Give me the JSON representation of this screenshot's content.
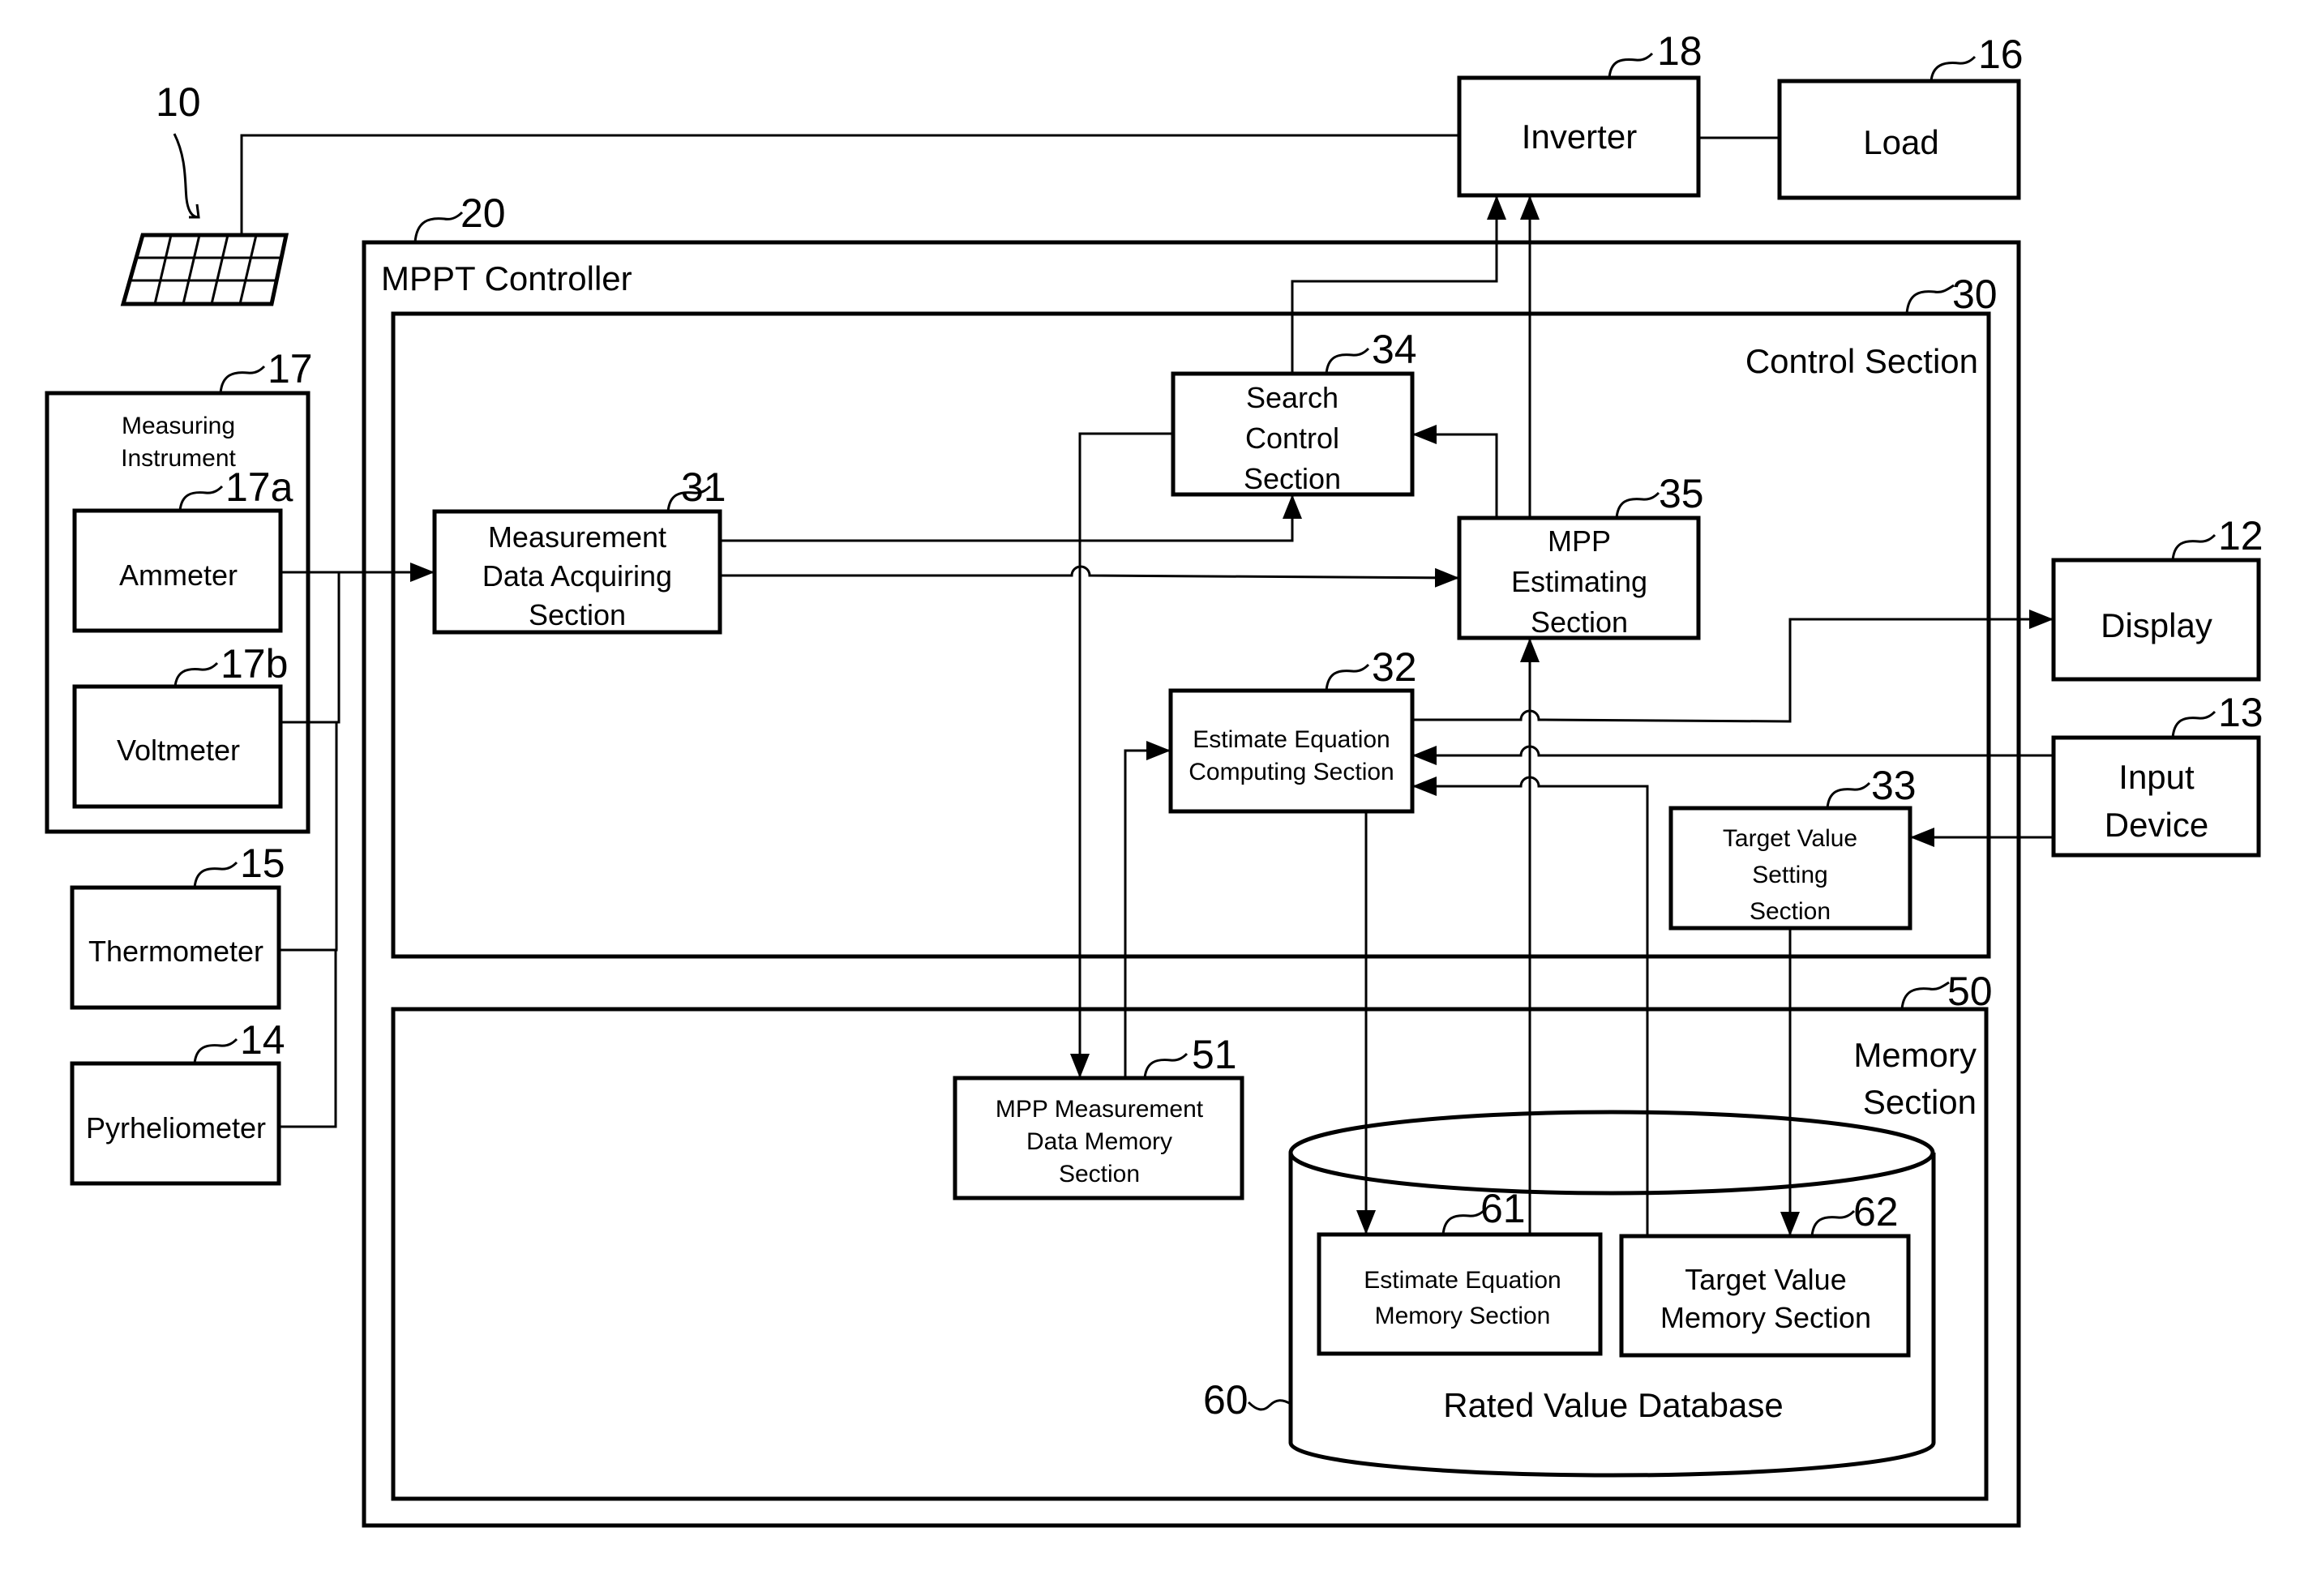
{
  "figure": {
    "description": "MPPT control system block diagram"
  },
  "components": {
    "solar_panel": {
      "ref": "10"
    },
    "inverter": {
      "ref": "18",
      "label": "Inverter"
    },
    "load": {
      "ref": "16",
      "label": "Load"
    },
    "mppt_controller": {
      "ref": "20",
      "label": "MPPT Controller"
    },
    "control_section": {
      "ref": "30",
      "label": "Control Section"
    },
    "memory_section": {
      "ref": "50",
      "label_lines": [
        "Memory",
        "Section"
      ]
    },
    "measuring_instrument": {
      "ref": "17",
      "label_lines": [
        "Measuring",
        "Instrument"
      ]
    },
    "ammeter": {
      "ref": "17a",
      "label": "Ammeter"
    },
    "voltmeter": {
      "ref": "17b",
      "label": "Voltmeter"
    },
    "thermometer": {
      "ref": "15",
      "label": "Thermometer"
    },
    "pyrheliometer": {
      "ref": "14",
      "label": "Pyrheliometer"
    },
    "measurement_data_acquiring": {
      "ref": "31",
      "label_lines": [
        "Measurement",
        "Data Acquiring",
        "Section"
      ]
    },
    "search_control": {
      "ref": "34",
      "label_lines": [
        "Search",
        "Control",
        "Section"
      ]
    },
    "mpp_estimating": {
      "ref": "35",
      "label_lines": [
        "MPP",
        "Estimating",
        "Section"
      ]
    },
    "estimate_equation_computing": {
      "ref": "32",
      "label_lines": [
        "Estimate Equation",
        "Computing Section"
      ]
    },
    "target_value_setting": {
      "ref": "33",
      "label_lines": [
        "Target Value",
        "Setting",
        "Section"
      ]
    },
    "display": {
      "ref": "12",
      "label": "Display"
    },
    "input_device": {
      "ref": "13",
      "label_lines": [
        "Input",
        "Device"
      ]
    },
    "mpp_measurement_data_memory": {
      "ref": "51",
      "label_lines": [
        "MPP Measurement",
        "Data Memory",
        "Section"
      ]
    },
    "rated_value_database": {
      "ref": "60",
      "label": "Rated Value Database"
    },
    "estimate_equation_memory": {
      "ref": "61",
      "label_lines": [
        "Estimate Equation",
        "Memory Section"
      ]
    },
    "target_value_memory": {
      "ref": "62",
      "label_lines": [
        "Target Value",
        "Memory Section"
      ]
    }
  },
  "connections": [
    {
      "from": "solar_panel",
      "to": "inverter",
      "type": "line"
    },
    {
      "from": "inverter",
      "to": "load",
      "type": "line"
    },
    {
      "from": "ammeter",
      "to": "measurement_data_acquiring",
      "type": "arrow"
    },
    {
      "from": "voltmeter",
      "to": "measurement_data_acquiring",
      "type": "arrow"
    },
    {
      "from": "thermometer",
      "to": "measurement_data_acquiring",
      "type": "arrow"
    },
    {
      "from": "pyrheliometer",
      "to": "measurement_data_acquiring",
      "type": "arrow"
    },
    {
      "from": "measurement_data_acquiring",
      "to": "search_control",
      "type": "arrow"
    },
    {
      "from": "measurement_data_acquiring",
      "to": "mpp_estimating",
      "type": "arrow"
    },
    {
      "from": "search_control",
      "to": "inverter",
      "type": "arrow"
    },
    {
      "from": "mpp_estimating",
      "to": "inverter",
      "type": "arrow"
    },
    {
      "from": "mpp_estimating",
      "to": "search_control",
      "type": "arrow"
    },
    {
      "from": "search_control",
      "to": "mpp_measurement_data_memory",
      "type": "arrow"
    },
    {
      "from": "mpp_measurement_data_memory",
      "to": "estimate_equation_computing",
      "type": "arrow"
    },
    {
      "from": "estimate_equation_computing",
      "to": "display",
      "type": "arrow"
    },
    {
      "from": "input_device",
      "to": "estimate_equation_computing",
      "type": "arrow"
    },
    {
      "from": "target_value_memory",
      "to": "estimate_equation_computing",
      "type": "arrow"
    },
    {
      "from": "input_device",
      "to": "target_value_setting",
      "type": "arrow"
    },
    {
      "from": "estimate_equation_computing",
      "to": "estimate_equation_memory",
      "type": "arrow"
    },
    {
      "from": "estimate_equation_memory",
      "to": "mpp_estimating",
      "type": "arrow"
    },
    {
      "from": "target_value_setting",
      "to": "target_value_memory",
      "type": "arrow"
    }
  ]
}
